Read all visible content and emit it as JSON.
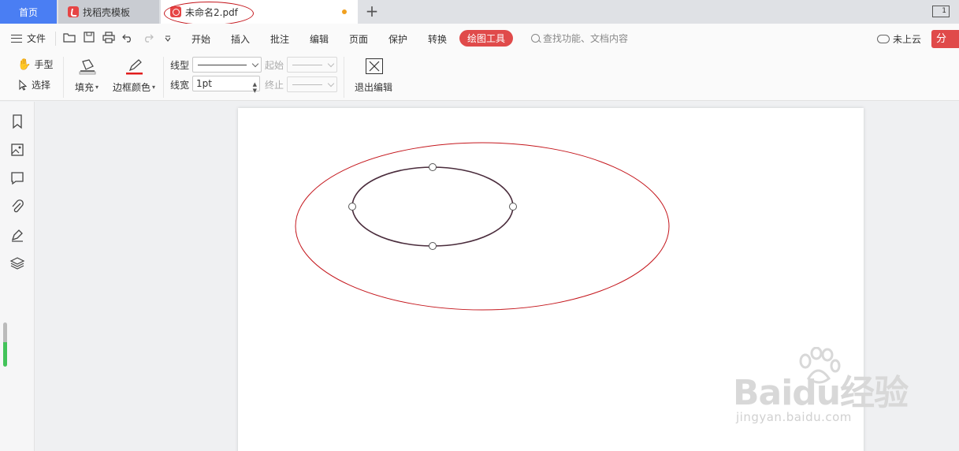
{
  "tabs": {
    "home": "首页",
    "template": "找稻壳模板",
    "document": "未命名2.pdf",
    "window_badge": "1"
  },
  "menu": {
    "file": "文件",
    "items": [
      "开始",
      "插入",
      "批注",
      "编辑",
      "页面",
      "保护",
      "转换"
    ],
    "active": "绘图工具",
    "search_placeholder": "查找功能、文档内容",
    "cloud": "未上云",
    "share": "分"
  },
  "ribbon": {
    "hand": "手型",
    "select": "选择",
    "fill": "填充",
    "border_color": "边框颜色",
    "line_type": "线型",
    "line_width": "线宽",
    "line_width_value": "1pt",
    "start": "起始",
    "end": "终止",
    "exit_edit": "退出编辑"
  },
  "watermark": {
    "brand": "Baidu经验",
    "url": "jingyan.baidu.com"
  },
  "colors": {
    "accent": "#e04a4a",
    "home_tab": "#4a7ef3",
    "outer_ellipse": "#c4161c",
    "inner_ellipse": "#4a2c3c"
  }
}
